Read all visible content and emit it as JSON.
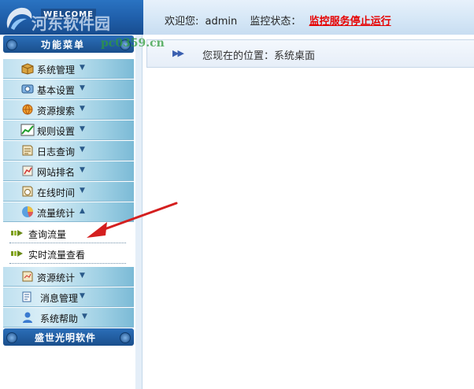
{
  "header": {
    "welcome_badge": "WELCOME",
    "watermark_name": "河东软件园",
    "watermark_url": "pc0359.cn",
    "welcome_label": "欢迎您:",
    "username": "admin",
    "monitor_label": "监控状态：",
    "monitor_state": "监控服务停止运行"
  },
  "sidebar": {
    "title": "功能菜单",
    "items": [
      {
        "label": "系统管理",
        "icon": "box-icon"
      },
      {
        "label": "基本设置",
        "icon": "settings-icon"
      },
      {
        "label": "资源搜索",
        "icon": "search-globe-icon"
      },
      {
        "label": "规则设置",
        "icon": "chart-icon"
      },
      {
        "label": "日志查询",
        "icon": "log-icon"
      },
      {
        "label": "网站排名",
        "icon": "ranking-icon"
      },
      {
        "label": "在线时间",
        "icon": "clock-icon"
      },
      {
        "label": "流量统计",
        "icon": "pie-chart-icon",
        "expanded": true
      },
      {
        "label": "资源统计",
        "icon": "resource-icon"
      },
      {
        "label": "消息管理",
        "icon": "message-icon"
      },
      {
        "label": "系统帮助",
        "icon": "help-icon"
      }
    ],
    "subitems": [
      {
        "label": "查询流量"
      },
      {
        "label": "实时流量查看"
      }
    ],
    "footer": "盛世光明软件"
  },
  "breadcrumb": {
    "label": "您现在的位置：系统桌面"
  },
  "colors": {
    "accent": "#1f5ea9",
    "status_red": "#e60000",
    "annotation_red": "#d41f1f"
  }
}
